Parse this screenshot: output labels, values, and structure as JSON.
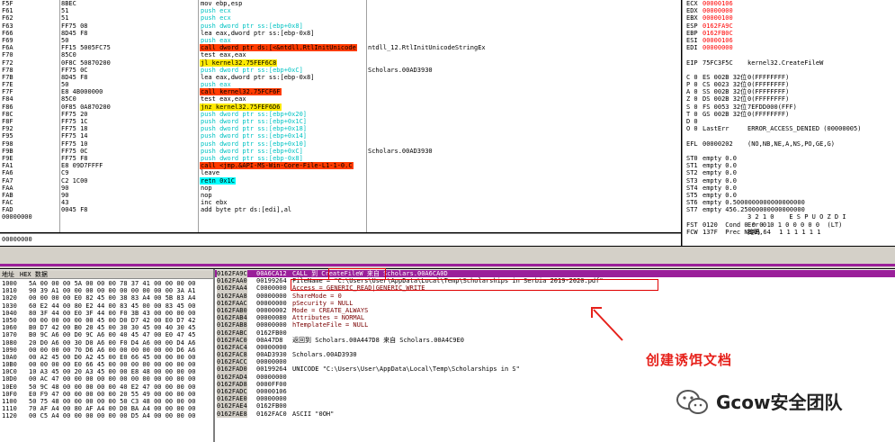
{
  "colors": {
    "call_bg": "#ff3b00",
    "push_fg": "#00c3c3",
    "jmp_bg": "#ffea00",
    "retn_bg": "#00ffff",
    "stack_bar": "#9a1f9a",
    "annotation": "#e6201a",
    "highlight": "#ff0000"
  },
  "cpu_rows": [
    {
      "addr": "F5F",
      "hex": "8BEC",
      "mn": "mov ebp,esp",
      "cm": ""
    },
    {
      "addr": "F61",
      "hex": "51",
      "mn": "push ecx",
      "cm": ""
    },
    {
      "addr": "F62",
      "hex": "51",
      "mn": "push ecx",
      "cm": ""
    },
    {
      "addr": "F63",
      "hex": "FF75 08",
      "mn": "push dword ptr ss:[ebp+0x8]",
      "cm": ""
    },
    {
      "addr": "F66",
      "hex": "8D45 F8",
      "mn": "lea eax,dword ptr ss:[ebp-0x8]",
      "cm": ""
    },
    {
      "addr": "F69",
      "hex": "50",
      "mn": "push eax",
      "cm": ""
    },
    {
      "addr": "F6A",
      "hex": "FF15 5005FC75",
      "mn": "call dword ptr ds:[<&ntdll.RtlInitUnicode",
      "cm": "ntdll_12.RtlInitUnicodeStringEx"
    },
    {
      "addr": "F70",
      "hex": "85C0",
      "mn": "test eax,eax",
      "cm": ""
    },
    {
      "addr": "F72",
      "hex": "0F8C 50870200",
      "mn": "jl kernel32.75FEF6C8",
      "cm": ""
    },
    {
      "addr": "F78",
      "hex": "FF75 0C",
      "mn": "push dword ptr ss:[ebp+0xC]",
      "cm": "Scholars.00AD3930"
    },
    {
      "addr": "F7B",
      "hex": "8D45 F8",
      "mn": "lea eax,dword ptr ss:[ebp-0x8]",
      "cm": ""
    },
    {
      "addr": "F7E",
      "hex": "50",
      "mn": "push eax",
      "cm": ""
    },
    {
      "addr": "F7F",
      "hex": "E8 4B000000",
      "mn": "call kernel32.75FCF6F",
      "cm": ""
    },
    {
      "addr": "F84",
      "hex": "85C0",
      "mn": "test eax,eax",
      "cm": ""
    },
    {
      "addr": "F86",
      "hex": "0F85 0A870200",
      "mn": "jnz kernel32.75FEF6D6",
      "cm": ""
    },
    {
      "addr": "F8C",
      "hex": "FF75 20",
      "mn": "push dword ptr ss:[ebp+0x20]",
      "cm": ""
    },
    {
      "addr": "F8F",
      "hex": "FF75 1C",
      "mn": "push dword ptr ss:[ebp+0x1C]",
      "cm": ""
    },
    {
      "addr": "F92",
      "hex": "FF75 18",
      "mn": "push dword ptr ss:[ebp+0x18]",
      "cm": ""
    },
    {
      "addr": "F95",
      "hex": "FF75 14",
      "mn": "push dword ptr ss:[ebp+0x14]",
      "cm": ""
    },
    {
      "addr": "F98",
      "hex": "FF75 10",
      "mn": "push dword ptr ss:[ebp+0x10]",
      "cm": ""
    },
    {
      "addr": "F9B",
      "hex": "FF75 0C",
      "mn": "push dword ptr ss:[ebp+0xC]",
      "cm": "Scholars.00AD3930"
    },
    {
      "addr": "F9E",
      "hex": "FF75 F8",
      "mn": "push dword ptr ss:[ebp-0x8]",
      "cm": ""
    },
    {
      "addr": "FA1",
      "hex": "E8 09D7FFFF",
      "mn": "call <jmp.&API-MS-Win-Core-File-L1-1-0.C",
      "cm": ""
    },
    {
      "addr": "FA6",
      "hex": "C9",
      "mn": "leave",
      "cm": ""
    },
    {
      "addr": "FA7",
      "hex": "C2 1C00",
      "mn": "retn 0x1C",
      "cm": ""
    },
    {
      "addr": "FAA",
      "hex": "90",
      "mn": "nop",
      "cm": ""
    },
    {
      "addr": "FAB",
      "hex": "90",
      "mn": "nop",
      "cm": ""
    },
    {
      "addr": "FAC",
      "hex": "43",
      "mn": "inc ebx",
      "cm": ""
    },
    {
      "addr": "FAD",
      "hex": "0045 F8",
      "mn": "add byte ptr ds:[edi],al",
      "cm": ""
    },
    {
      "addr": "00000000",
      "hex": "",
      "mn": "",
      "cm": ""
    }
  ],
  "registers": [
    {
      "k": "ECX",
      "v": "00000106",
      "d": ""
    },
    {
      "k": "EDX",
      "v": "00000000",
      "d": ""
    },
    {
      "k": "EBX",
      "v": "00000100",
      "d": ""
    },
    {
      "k": "ESP",
      "v": "0162FA9C",
      "d": ""
    },
    {
      "k": "EBP",
      "v": "0162FB0C",
      "d": ""
    },
    {
      "k": "ESI",
      "v": "00000106",
      "d": ""
    },
    {
      "k": "EDI",
      "v": "00000000",
      "d": ""
    },
    {
      "k": "",
      "v": "",
      "d": ""
    },
    {
      "k": "EIP",
      "v": "75FC3F5C",
      "d": "kernel32.CreateFileW"
    },
    {
      "k": "",
      "v": "",
      "d": ""
    },
    {
      "k": "C 0",
      "v": "ES 002B 32位",
      "d": "0(FFFFFFFF)"
    },
    {
      "k": "P 0",
      "v": "CS 0023 32位",
      "d": "0(FFFFFFFF)"
    },
    {
      "k": "A 0",
      "v": "SS 002B 32位",
      "d": "0(FFFFFFFF)"
    },
    {
      "k": "Z 0",
      "v": "DS 002B 32位",
      "d": "0(FFFFFFFF)"
    },
    {
      "k": "S 0",
      "v": "FS 0053 32位",
      "d": "7EFDD000(FFF)"
    },
    {
      "k": "T 0",
      "v": "GS 002B 32位",
      "d": "0(FFFFFFFF)"
    },
    {
      "k": "D 0",
      "v": "",
      "d": ""
    },
    {
      "k": "O 0",
      "v": "LastErr",
      "d": "ERROR_ACCESS_DENIED (00000005)"
    },
    {
      "k": "",
      "v": "",
      "d": ""
    },
    {
      "k": "EFL",
      "v": "00000202",
      "d": "(NO,NB,NE,A,NS,PO,GE,G)"
    },
    {
      "k": "",
      "v": "",
      "d": ""
    },
    {
      "k": "ST0",
      "v": "empty 0.0",
      "d": ""
    },
    {
      "k": "ST1",
      "v": "empty 0.0",
      "d": ""
    },
    {
      "k": "ST2",
      "v": "empty 0.0",
      "d": ""
    },
    {
      "k": "ST3",
      "v": "empty 0.0",
      "d": ""
    },
    {
      "k": "ST4",
      "v": "empty 0.0",
      "d": ""
    },
    {
      "k": "ST5",
      "v": "empty 0.0",
      "d": ""
    },
    {
      "k": "ST6",
      "v": "empty 0.5000000000000000000",
      "d": ""
    },
    {
      "k": "ST7",
      "v": "empty 456.25000000000000000",
      "d": ""
    },
    {
      "k": "",
      "v": "",
      "d": "3 2 1 0    E S P U O Z D I"
    },
    {
      "k": "FST",
      "v": "0120  Cond 0 0 0 1",
      "d": "Err 0 0 1 0 0 0 0 0  (LT)"
    },
    {
      "k": "FCW",
      "v": "137F  Prec NEAR,64",
      "d": "掩码     1 1 1 1 1 1"
    }
  ],
  "info_line": "00000000",
  "dump_header": {
    "addr": "地址",
    "hex": "HEX 数据"
  },
  "dump_rows": [
    {
      "a": "1000",
      "x": "5A 00 00 00 5A 00 00 00 78 37 41 00 00 00 00"
    },
    {
      "a": "1010",
      "x": "90 39 A1 00 00 00 00 00 00 00 00 00 00 3A A1"
    },
    {
      "a": "1020",
      "x": "00 00 00 00 E0 82 45 00 38 83 A4 00 5B 83 A4"
    },
    {
      "a": "1030",
      "x": "60 E2 44 00 80 E2 44 00 83 45 00 00 83 45 00"
    },
    {
      "a": "1040",
      "x": "80 3F 44 00 E0 3F 44 00 F0 3B 43 00 00 00 00"
    },
    {
      "a": "1050",
      "x": "00 00 00 00 00 00 45 00 D0 D7 42 00 E0 D7 42"
    },
    {
      "a": "1060",
      "x": "B0 D7 42 00 B0 20 45 00 30 30 45 00 40 30 45"
    },
    {
      "a": "1070",
      "x": "B0 9C A6 00 D0 9C A6 00 40 45 47 00 E0 47 45"
    },
    {
      "a": "1080",
      "x": "20 D0 A6 00 30 D0 A6 00 F0 D4 A6 00 00 D4 A6"
    },
    {
      "a": "1090",
      "x": "00 00 00 00 70 D6 A6 00 00 00 00 00 00 D6 A6"
    },
    {
      "a": "10A0",
      "x": "00 A2 45 00 D0 A2 45 00 E0 66 45 00 00 00 00"
    },
    {
      "a": "10B0",
      "x": "00 00 00 00 E0 66 45 00 00 00 00 00 00 00 00"
    },
    {
      "a": "10C0",
      "x": "10 A3 45 00 20 A3 45 00 00 E8 48 00 00 00 00"
    },
    {
      "a": "10D0",
      "x": "00 AC 47 00 00 00 00 00 00 00 00 00 00 00 00"
    },
    {
      "a": "10E0",
      "x": "50 9C 48 00 00 00 00 00 40 E2 47 00 00 00 00"
    },
    {
      "a": "10F0",
      "x": "E0 F9 47 00 00 00 00 00 20 55 49 00 00 00 00"
    },
    {
      "a": "1100",
      "x": "50 75 48 00 00 00 00 00 50 C3 48 00 00 00 00"
    },
    {
      "a": "1110",
      "x": "70 AF A4 00 80 AF A4 00 D0 BA A4 00 00 00 00"
    },
    {
      "a": "1120",
      "x": "00 C5 A4 00 00 00 00 00 00 D5 A4 00 00 00 00"
    }
  ],
  "stack_header": {
    "a": "0162FA9C",
    "v": "00A6CA12",
    "c": "CALL 到 CreateFileW 来自 Scholars.00A6CA0D"
  },
  "stack_rows": [
    {
      "a": "0162FAA0",
      "v": "00199264",
      "c": "FileName = \"C:\\Users\\User\\AppData\\Local\\Temp\\Scholarships in Serbia 2019-2020.pdf\""
    },
    {
      "a": "0162FAA4",
      "v": "C0000000",
      "c": "Access = GENERIC_READ|GENERIC_WRITE"
    },
    {
      "a": "0162FAA8",
      "v": "00000000",
      "c": "ShareMode = 0"
    },
    {
      "a": "0162FAAC",
      "v": "00000000",
      "c": "pSecurity = NULL"
    },
    {
      "a": "0162FAB0",
      "v": "00000002",
      "c": "Mode = CREATE_ALWAYS"
    },
    {
      "a": "0162FAB4",
      "v": "00000080",
      "c": "Attributes = NORMAL"
    },
    {
      "a": "0162FAB8",
      "v": "00000000",
      "c": "hTemplateFile = NULL"
    },
    {
      "a": "0162FABC",
      "v": "0162FB00",
      "c": ""
    },
    {
      "a": "0162FAC0",
      "v": "00A47D8",
      "c": "返回到 Scholars.00A447D8 来自 Scholars.00A4C9E0"
    },
    {
      "a": "0162FAC4",
      "v": "00000000",
      "c": ""
    },
    {
      "a": "0162FAC8",
      "v": "00AD3930",
      "c": "Scholars.00AD3930"
    },
    {
      "a": "0162FACC",
      "v": "00000000",
      "c": ""
    },
    {
      "a": "0162FAD0",
      "v": "00199264",
      "c": "UNICODE \"C:\\Users\\User\\AppData\\Local\\Temp\\Scholarships in S\""
    },
    {
      "a": "0162FAD4",
      "v": "00000000",
      "c": ""
    },
    {
      "a": "0162FAD8",
      "v": "0000FF00",
      "c": ""
    },
    {
      "a": "0162FADC",
      "v": "00000106",
      "c": ""
    },
    {
      "a": "0162FAE0",
      "v": "00000000",
      "c": ""
    },
    {
      "a": "0162FAE4",
      "v": "0162FB00",
      "c": ""
    },
    {
      "a": "0162FAE8",
      "v": "0162FAC0",
      "c": "ASCII \"0OH\""
    }
  ],
  "annotation": "创建诱饵文档",
  "watermark": "Gcow安全团队"
}
